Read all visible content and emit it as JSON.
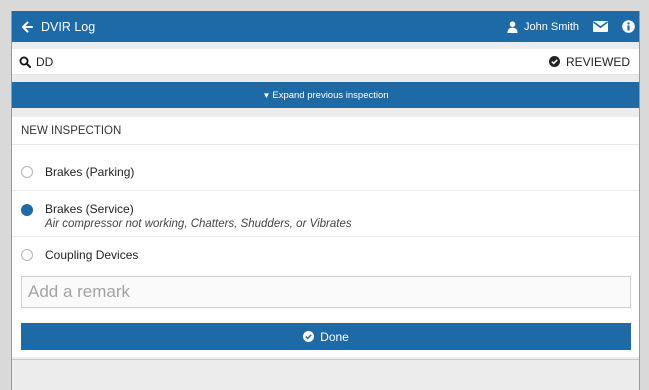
{
  "header": {
    "title": "DVIR Log",
    "user_name": "John Smith",
    "back_icon": "arrow-left-icon",
    "user_icon": "user-icon",
    "mail_icon": "envelope-icon",
    "info_icon": "info-icon"
  },
  "search": {
    "query": "DD",
    "status_label": "REVIEWED"
  },
  "expand": {
    "label": "Expand previous inspection"
  },
  "inspection": {
    "section_title": "NEW INSPECTION",
    "items": [
      {
        "label": "Brakes (Parking)",
        "checked": false,
        "note": ""
      },
      {
        "label": "Brakes (Service)",
        "checked": true,
        "note": "Air compressor not working, Chatters, Shudders, or Vibrates"
      },
      {
        "label": "Coupling Devices",
        "checked": false,
        "note": ""
      }
    ],
    "remark_placeholder": "Add a remark",
    "done_label": "Done"
  },
  "colors": {
    "accent": "#1e6aa6",
    "background": "#ececec"
  }
}
